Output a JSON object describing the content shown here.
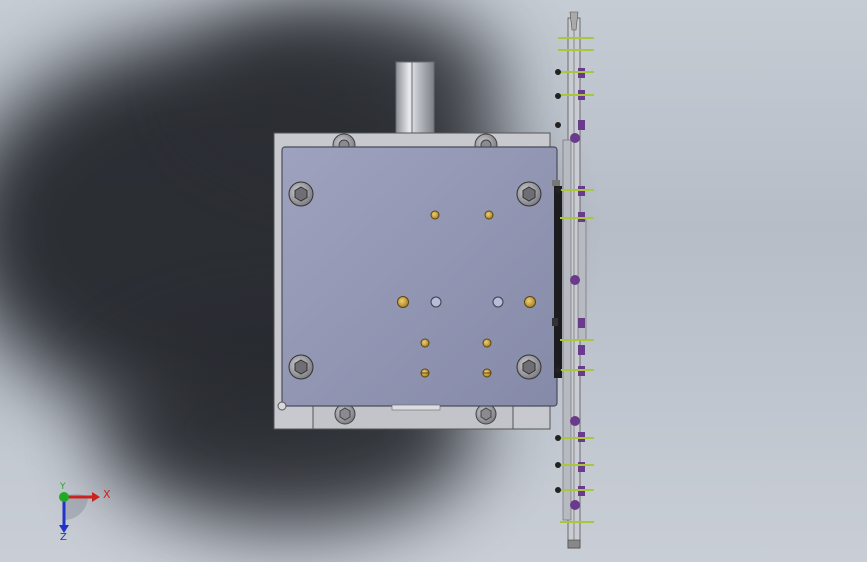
{
  "viewport": {
    "background_top": "#c6ccd4",
    "background_bottom": "#c9ced6",
    "shadow_color": "#2b2e33"
  },
  "model": {
    "plate_color": "#8f93b1",
    "frame_color": "#c4c6cb",
    "screw_color": "#9a9aa0",
    "brass_color": "#c8a23c",
    "bolt_purple": "#6a3a8c",
    "pin_green": "#a8c83a"
  },
  "triad": {
    "x_label": "X",
    "y_label": "Y",
    "z_label": "Z",
    "x_color": "#cc2222",
    "y_color": "#22aa22",
    "z_color": "#2233cc"
  }
}
